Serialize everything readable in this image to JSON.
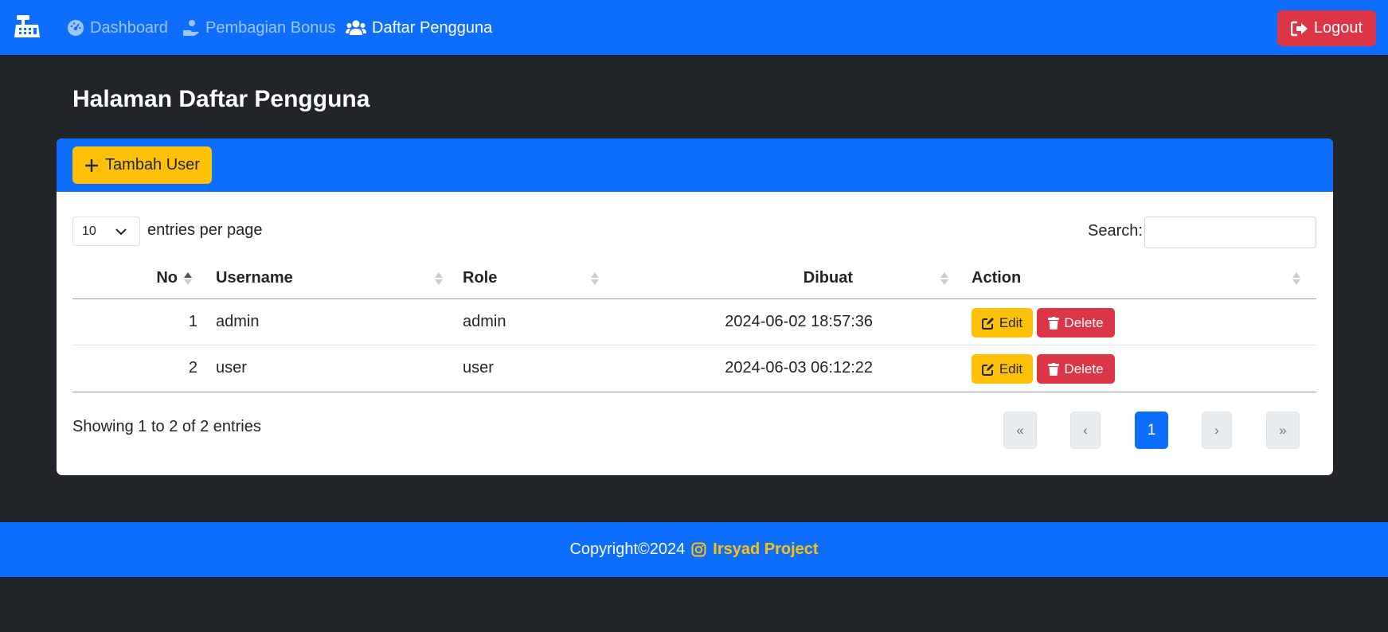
{
  "nav": {
    "items": [
      {
        "label": "Dashboard",
        "icon": "gauge-icon",
        "active": false
      },
      {
        "label": "Pembagian Bonus",
        "icon": "hand-coin-icon",
        "active": false
      },
      {
        "label": "Daftar Pengguna",
        "icon": "users-icon",
        "active": true
      }
    ],
    "logout_label": "Logout"
  },
  "page": {
    "title": "Halaman Daftar Pengguna"
  },
  "toolbar": {
    "add_label": "Tambah User"
  },
  "table_controls": {
    "per_page_value": "10",
    "per_page_label": "entries per page",
    "search_label": "Search:",
    "search_value": ""
  },
  "table": {
    "columns": [
      "No",
      "Username",
      "Role",
      "Dibuat",
      "Action"
    ],
    "rows": [
      {
        "no": "1",
        "username": "admin",
        "role": "admin",
        "dibuat": "2024-06-02 18:57:36"
      },
      {
        "no": "2",
        "username": "user",
        "role": "user",
        "dibuat": "2024-06-03 06:12:22"
      }
    ],
    "edit_label": "Edit",
    "delete_label": "Delete"
  },
  "pagination": {
    "info": "Showing 1 to 2 of 2 entries",
    "first": "«",
    "prev": "‹",
    "current": "1",
    "next": "›",
    "last": "»"
  },
  "footer": {
    "copyright": "Copyright©2024",
    "brand": "Irsyad Project"
  },
  "colors": {
    "primary": "#0d6efd",
    "warning": "#ffc107",
    "danger": "#dc3545",
    "dark": "#212529"
  }
}
